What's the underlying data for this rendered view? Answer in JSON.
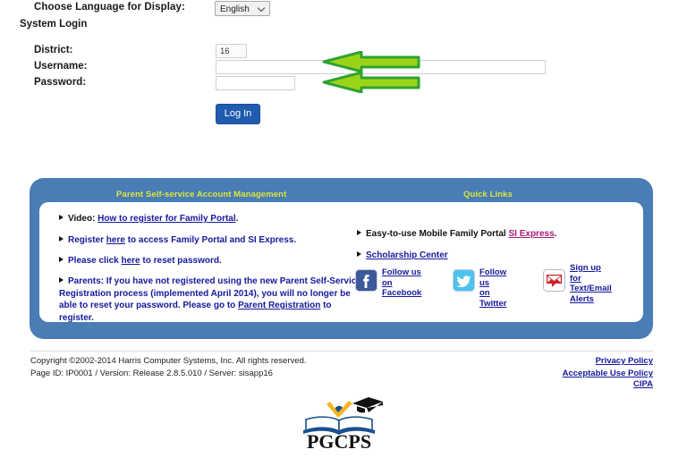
{
  "login": {
    "language_label": "Choose Language for Display:",
    "language_value": "English",
    "language_options": [
      "English"
    ],
    "section_title": "System Login",
    "district_label": "District:",
    "district_value": "16",
    "username_label": "Username:",
    "username_value": "",
    "password_label": "Password:",
    "password_value": "",
    "login_button": "Log In"
  },
  "annotations": {
    "arrow_fill": "#9BD417",
    "arrow_stroke": "#2FA331",
    "arrow_username_target": "Username",
    "arrow_password_target": "Password"
  },
  "panel": {
    "background": "#4A7CB5",
    "heading_color": "#D9E83A",
    "left_heading": "Parent Self-service Account Management",
    "right_heading": "Quick Links",
    "rows": {
      "video_prefix": "Video: ",
      "video_link": "How to register for Family Portal",
      "video_suffix": ".",
      "register_prefix": "Register ",
      "register_link": "here",
      "register_suffix": " to access Family Portal and SI Express.",
      "reset_prefix": "Please click ",
      "reset_link": "here",
      "reset_suffix": " to reset password.",
      "parents_part1": "Parents: If you have not registered using the new Parent Self-Service Registration process (implemented April 2014), you will no longer be able to reset your password. Please go to ",
      "parents_link": "Parent Registration",
      "parents_part2": " to register."
    },
    "quick_links": {
      "siexpress_prefix": "Easy-to-use Mobile Family Portal ",
      "siexpress_link": "SI Express",
      "siexpress_suffix": ".",
      "scholarship_link": "Scholarship Center"
    },
    "social": [
      {
        "icon": "facebook-icon",
        "line1": "Follow us on",
        "line2": "Facebook",
        "line3": ""
      },
      {
        "icon": "twitter-icon",
        "line1": "Follow us",
        "line2": "on Twitter",
        "line3": ""
      },
      {
        "icon": "email-alert-icon",
        "line1": "Sign up for",
        "line2": "Text/Email",
        "line3": "Alerts"
      }
    ]
  },
  "footer": {
    "copyright": "Copyright ©2002-2014 Harris Computer Systems, Inc. All rights reserved.",
    "page_info": "Page ID: IP0001 / Version: Release 2.8.5.010 / Server: sisapp16",
    "privacy_policy": "Privacy Policy",
    "acceptable_use_policy": "Acceptable Use Policy",
    "cipa": "CIPA"
  },
  "logo": {
    "text": "PGCPS",
    "alt": "Prince George's County Public Schools logo"
  }
}
